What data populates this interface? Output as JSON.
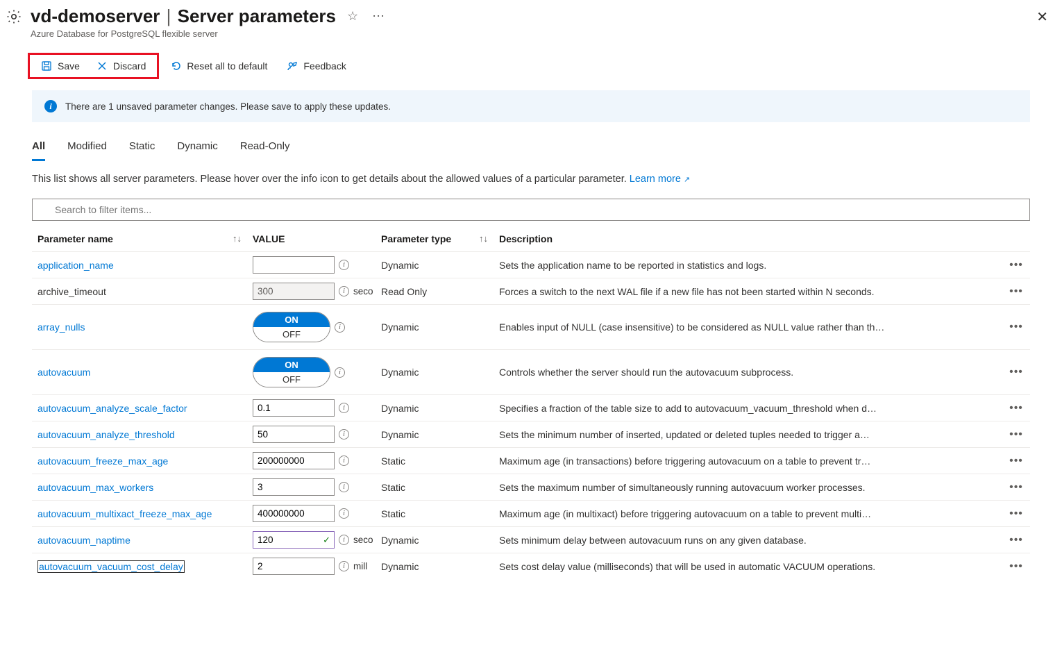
{
  "header": {
    "server_name": "vd-demoserver",
    "page_title": "Server parameters",
    "subtitle": "Azure Database for PostgreSQL flexible server"
  },
  "toolbar": {
    "save_label": "Save",
    "discard_label": "Discard",
    "reset_label": "Reset all to default",
    "feedback_label": "Feedback"
  },
  "banner": {
    "text": "There are 1 unsaved parameter changes.  Please save to apply these updates."
  },
  "tabs": [
    "All",
    "Modified",
    "Static",
    "Dynamic",
    "Read-Only"
  ],
  "active_tab": "All",
  "description": {
    "text": "This list shows all server parameters. Please hover over the info icon to get details about the allowed values of a particular parameter. ",
    "link_text": "Learn more"
  },
  "search": {
    "placeholder": "Search to filter items..."
  },
  "columns": {
    "name": "Parameter name",
    "value": "VALUE",
    "type": "Parameter type",
    "desc": "Description"
  },
  "on_label": "ON",
  "off_label": "OFF",
  "rows": [
    {
      "name": "application_name",
      "link": true,
      "input_type": "text",
      "value": "",
      "unit": "",
      "type": "Dynamic",
      "desc": "Sets the application name to be reported in statistics and logs."
    },
    {
      "name": "archive_timeout",
      "link": false,
      "input_type": "text",
      "value": "300",
      "readonly": true,
      "unit": "seconds",
      "type": "Read Only",
      "desc": "Forces a switch to the next WAL file if a new file has not been started within N seconds."
    },
    {
      "name": "array_nulls",
      "link": true,
      "input_type": "toggle",
      "value": "ON",
      "type": "Dynamic",
      "desc": "Enables input of NULL (case insensitive) to be considered as NULL value rather than th…"
    },
    {
      "name": "autovacuum",
      "link": true,
      "input_type": "toggle",
      "value": "ON",
      "type": "Dynamic",
      "desc": "Controls whether the server should run the autovacuum subprocess."
    },
    {
      "name": "autovacuum_analyze_scale_factor",
      "link": true,
      "input_type": "text",
      "value": "0.1",
      "type": "Dynamic",
      "desc": "Specifies a fraction of the table size to add to autovacuum_vacuum_threshold when d…"
    },
    {
      "name": "autovacuum_analyze_threshold",
      "link": true,
      "input_type": "text",
      "value": "50",
      "type": "Dynamic",
      "desc": "Sets the minimum number of inserted, updated or deleted tuples needed to trigger a…"
    },
    {
      "name": "autovacuum_freeze_max_age",
      "link": true,
      "input_type": "text",
      "value": "200000000",
      "type": "Static",
      "desc": "Maximum age (in transactions) before triggering autovacuum on a table to prevent tr…"
    },
    {
      "name": "autovacuum_max_workers",
      "link": true,
      "input_type": "text",
      "value": "3",
      "type": "Static",
      "desc": "Sets the maximum number of simultaneously running autovacuum worker processes."
    },
    {
      "name": "autovacuum_multixact_freeze_max_age",
      "link": true,
      "input_type": "text",
      "value": "400000000",
      "type": "Static",
      "desc": "Maximum age (in multixact) before triggering autovacuum on a table to prevent multi…"
    },
    {
      "name": "autovacuum_naptime",
      "link": true,
      "input_type": "text",
      "value": "120",
      "changed": true,
      "unit": "seconds",
      "type": "Dynamic",
      "desc": "Sets minimum delay between autovacuum runs on any given database."
    },
    {
      "name": "autovacuum_vacuum_cost_delay",
      "link": true,
      "selected": true,
      "input_type": "text",
      "value": "2",
      "unit": "milliseconds",
      "type": "Dynamic",
      "desc": "Sets cost delay value (milliseconds) that will be used in automatic VACUUM operations."
    }
  ]
}
